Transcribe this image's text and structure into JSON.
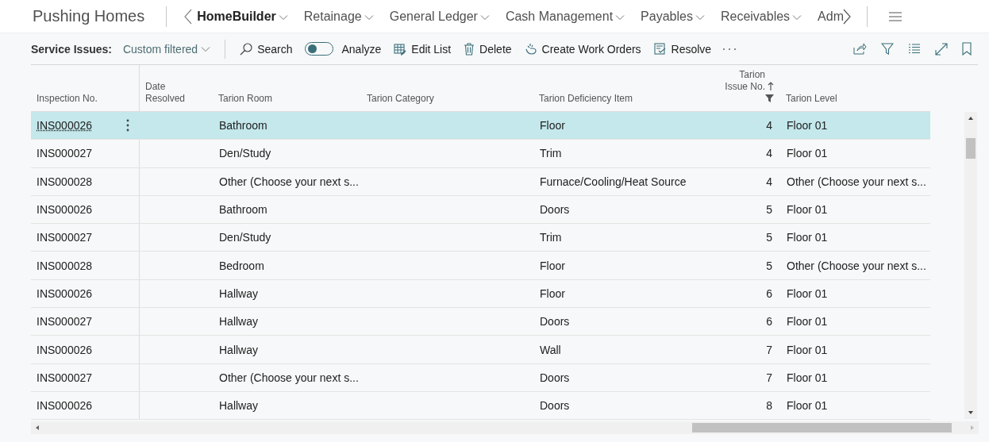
{
  "app": {
    "title": "Pushing Homes"
  },
  "nav": {
    "items": [
      {
        "label": "HomeBuilder",
        "selected": true
      },
      {
        "label": "Retainage",
        "selected": false
      },
      {
        "label": "General Ledger",
        "selected": false
      },
      {
        "label": "Cash Management",
        "selected": false
      },
      {
        "label": "Payables",
        "selected": false
      },
      {
        "label": "Receivables",
        "selected": false
      }
    ],
    "overflow_item": "Adm"
  },
  "toolbar": {
    "page_title": "Service Issues:",
    "view": "Custom filtered",
    "actions": [
      {
        "kind": "search",
        "label": "Search"
      },
      {
        "kind": "toggle",
        "label": "Analyze",
        "on": false
      },
      {
        "kind": "editlist",
        "label": "Edit List"
      },
      {
        "kind": "delete",
        "label": "Delete"
      },
      {
        "kind": "workorders",
        "label": "Create Work Orders"
      },
      {
        "kind": "resolve",
        "label": "Resolve"
      }
    ]
  },
  "table": {
    "columns": [
      {
        "kind": "link",
        "label": "Inspection No."
      },
      {
        "kind": "text",
        "label": "Date Resolved"
      },
      {
        "kind": "text",
        "label": "Tarion Room"
      },
      {
        "kind": "text",
        "label": "Tarion Category"
      },
      {
        "kind": "text",
        "label": "Tarion Deficiency Item"
      },
      {
        "kind": "number",
        "label": "Tarion Issue No.",
        "sort_ascending": true,
        "filtered": true
      },
      {
        "kind": "text",
        "label": "Tarion Level"
      }
    ],
    "rows": [
      {
        "cells": [
          "INS000026",
          null,
          "Bathroom",
          null,
          "Floor",
          "4",
          "Floor 01"
        ],
        "selected": true
      },
      {
        "cells": [
          "INS000027",
          null,
          "Den/Study",
          null,
          "Trim",
          "4",
          "Floor 01"
        ],
        "selected": false
      },
      {
        "cells": [
          "INS000028",
          null,
          "Other (Choose your next s...",
          null,
          "Furnace/Cooling/Heat Source",
          "4",
          "Other (Choose your next s..."
        ],
        "selected": false
      },
      {
        "cells": [
          "INS000026",
          null,
          "Bathroom",
          null,
          "Doors",
          "5",
          "Floor 01"
        ],
        "selected": false
      },
      {
        "cells": [
          "INS000027",
          null,
          "Den/Study",
          null,
          "Trim",
          "5",
          "Floor 01"
        ],
        "selected": false
      },
      {
        "cells": [
          "INS000028",
          null,
          "Bedroom",
          null,
          "Floor",
          "5",
          "Other (Choose your next s..."
        ],
        "selected": false
      },
      {
        "cells": [
          "INS000026",
          null,
          "Hallway",
          null,
          "Floor",
          "6",
          "Floor 01"
        ],
        "selected": false
      },
      {
        "cells": [
          "INS000027",
          null,
          "Hallway",
          null,
          "Doors",
          "6",
          "Floor 01"
        ],
        "selected": false
      },
      {
        "cells": [
          "INS000026",
          null,
          "Hallway",
          null,
          "Wall",
          "7",
          "Floor 01"
        ],
        "selected": false
      },
      {
        "cells": [
          "INS000027",
          null,
          "Other (Choose your next s...",
          null,
          "Doors",
          "7",
          "Floor 01"
        ],
        "selected": false
      },
      {
        "cells": [
          "INS000026",
          null,
          "Hallway",
          null,
          "Doors",
          "8",
          "Floor 01"
        ],
        "selected": false
      }
    ]
  }
}
